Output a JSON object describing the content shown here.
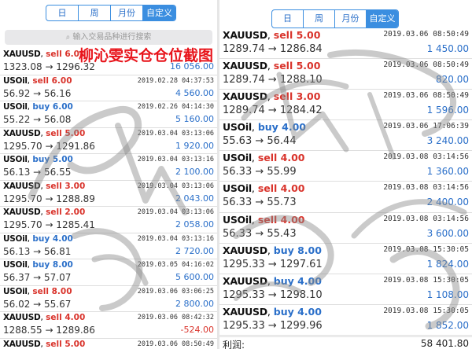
{
  "left": {
    "tabs": [
      "日",
      "周",
      "月份",
      "自定义"
    ],
    "active_tab": 3,
    "search_placeholder": "输入交易品种进行搜索",
    "orders": [
      {
        "symbol": "XAUUSD",
        "side": "sell",
        "action": "sell 6.00",
        "time": "",
        "prices": "1323.08 → 1296.32",
        "profit": "16 056.00"
      },
      {
        "symbol": "USOil",
        "side": "sell",
        "action": "sell 6.00",
        "time": "2019.02.28 04:37:53",
        "prices": "56.92 → 56.16",
        "profit": "4 560.00"
      },
      {
        "symbol": "USOil",
        "side": "buy",
        "action": "buy 6.00",
        "time": "2019.02.26 04:14:30",
        "prices": "55.22 → 56.08",
        "profit": "5 160.00"
      },
      {
        "symbol": "XAUUSD",
        "side": "sell",
        "action": "sell 5.00",
        "time": "2019.03.04 03:13:06",
        "prices": "1295.70 → 1291.86",
        "profit": "1 920.00"
      },
      {
        "symbol": "USOil",
        "side": "buy",
        "action": "buy 5.00",
        "time": "2019.03.04 03:13:16",
        "prices": "56.13 → 56.55",
        "profit": "2 100.00"
      },
      {
        "symbol": "XAUUSD",
        "side": "sell",
        "action": "sell 3.00",
        "time": "2019.03.04 03:13:06",
        "prices": "1295.70 → 1288.89",
        "profit": "2 043.00"
      },
      {
        "symbol": "XAUUSD",
        "side": "sell",
        "action": "sell 2.00",
        "time": "2019.03.04 03:13:06",
        "prices": "1295.70 → 1285.41",
        "profit": "2 058.00"
      },
      {
        "symbol": "USOil",
        "side": "buy",
        "action": "buy 4.00",
        "time": "2019.03.04 03:13:16",
        "prices": "56.13 → 56.81",
        "profit": "2 720.00"
      },
      {
        "symbol": "USOil",
        "side": "buy",
        "action": "buy 8.00",
        "time": "2019.03.05 04:16:02",
        "prices": "56.37 → 57.07",
        "profit": "5 600.00"
      },
      {
        "symbol": "USOil",
        "side": "sell",
        "action": "sell 8.00",
        "time": "2019.03.06 03:06:25",
        "prices": "56.02 → 55.67",
        "profit": "2 800.00"
      },
      {
        "symbol": "XAUUSD",
        "side": "sell",
        "action": "sell 4.00",
        "time": "2019.03.06 08:42:32",
        "prices": "1288.55 → 1289.86",
        "profit": "-524.00"
      },
      {
        "symbol": "XAUUSD",
        "side": "sell",
        "action": "sell 5.00",
        "time": "2019.03.06 08:50:49",
        "prices": "",
        "profit": ""
      }
    ]
  },
  "right": {
    "tabs": [
      "日",
      "周",
      "月份",
      "自定义"
    ],
    "active_tab": 3,
    "orders": [
      {
        "symbol": "XAUUSD",
        "side": "sell",
        "action": "sell 5.00",
        "time": "2019.03.06 08:50:49",
        "prices": "1289.74 → 1286.84",
        "profit": "1 450.00"
      },
      {
        "symbol": "XAUUSD",
        "side": "sell",
        "action": "sell 5.00",
        "time": "2019.03.06 08:50:49",
        "prices": "1289.74 → 1288.10",
        "profit": "820.00"
      },
      {
        "symbol": "XAUUSD",
        "side": "sell",
        "action": "sell 3.00",
        "time": "2019.03.06 08:50:49",
        "prices": "1289.74 → 1284.42",
        "profit": "1 596.00"
      },
      {
        "symbol": "USOil",
        "side": "buy",
        "action": "buy 4.00",
        "time": "2019.03.06 17:06:39",
        "prices": "55.63 → 56.44",
        "profit": "3 240.00"
      },
      {
        "symbol": "USOil",
        "side": "sell",
        "action": "sell 4.00",
        "time": "2019.03.08 03:14:56",
        "prices": "56.33 → 55.99",
        "profit": "1 360.00"
      },
      {
        "symbol": "USOil",
        "side": "sell",
        "action": "sell 4.00",
        "time": "2019.03.08 03:14:56",
        "prices": "56.33 → 55.73",
        "profit": "2 400.00"
      },
      {
        "symbol": "USOil",
        "side": "sell",
        "action": "sell 4.00",
        "time": "2019.03.08 03:14:56",
        "prices": "56.33 → 55.43",
        "profit": "3 600.00"
      },
      {
        "symbol": "XAUUSD",
        "side": "buy",
        "action": "buy 8.00",
        "time": "2019.03.08 15:30:05",
        "prices": "1295.33 → 1297.61",
        "profit": "1 824.00"
      },
      {
        "symbol": "XAUUSD",
        "side": "buy",
        "action": "buy 4.00",
        "time": "2019.03.08 15:30:05",
        "prices": "1295.33 → 1298.10",
        "profit": "1 108.00"
      },
      {
        "symbol": "XAUUSD",
        "side": "buy",
        "action": "buy 4.00",
        "time": "2019.03.08 15:30:05",
        "prices": "1295.33 → 1299.96",
        "profit": "1 852.00"
      }
    ],
    "profit_label": "利润:",
    "profit_value": "58 401.80"
  },
  "banner": "柳沁雯实仓仓位截图",
  "colors": {
    "accent": "#3b8ee0",
    "buy": "#2a6fc9",
    "sell": "#d9332b",
    "banner": "#e8141b"
  }
}
